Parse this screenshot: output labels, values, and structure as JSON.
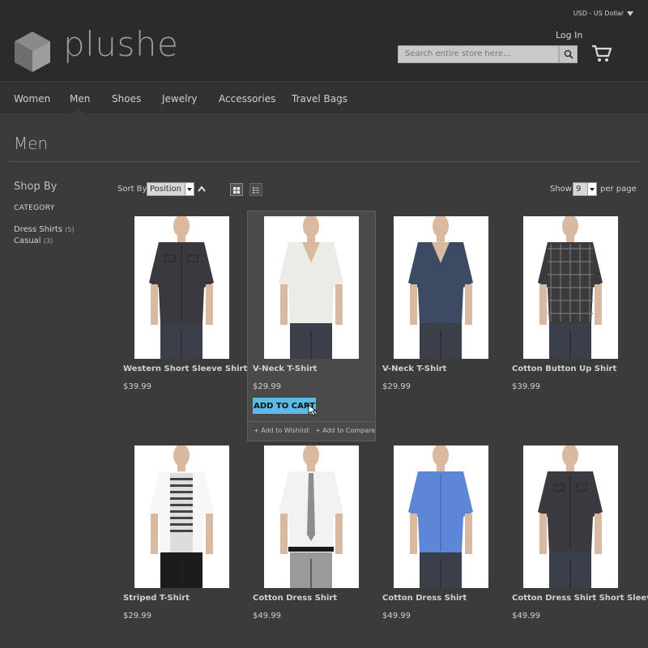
{
  "header": {
    "brand": "plushe",
    "currency": "USD - US Dollar",
    "login": "Log In",
    "search_placeholder": "Search entire store here..."
  },
  "nav": {
    "items": [
      "Women",
      "Men",
      "Shoes",
      "Jewelry",
      "Accessories",
      "Travel Bags"
    ],
    "active": "Men"
  },
  "page": {
    "title": "Men"
  },
  "sidebar": {
    "heading": "Shop By",
    "category_label": "CATEGORY",
    "categories": [
      {
        "label": "Dress Shirts",
        "count": "(5)"
      },
      {
        "label": "Casual",
        "count": "(3)"
      }
    ]
  },
  "toolbar": {
    "sort_label": "Sort By",
    "sort_value": "Position",
    "show_label": "Show",
    "show_value": "9",
    "per_page": "per page"
  },
  "products": [
    {
      "name": "Western Short Sleeve Shirt",
      "price": "$39.99",
      "shirt_color": "#3a3940",
      "style": "dark-button"
    },
    {
      "name": "V-Neck T-Shirt",
      "price": "$29.99",
      "shirt_color": "#ecebe6",
      "style": "vneck"
    },
    {
      "name": "V-Neck T-Shirt",
      "price": "$29.99",
      "shirt_color": "#3c4a63",
      "style": "vneck"
    },
    {
      "name": "Cotton Button Up Shirt",
      "price": "$39.99",
      "shirt_color": "#3b3b3d",
      "style": "plaid"
    },
    {
      "name": "Striped T-Shirt",
      "price": "$29.99",
      "shirt_color": "#f4f4f4",
      "style": "blazer"
    },
    {
      "name": "Cotton Dress Shirt",
      "price": "$49.99",
      "shirt_color": "#f2f2f2",
      "style": "dress-tie"
    },
    {
      "name": "Cotton Dress Shirt",
      "price": "$49.99",
      "shirt_color": "#5d86d6",
      "style": "dress-blue"
    },
    {
      "name": "Cotton Dress Shirt Short Sleeve",
      "price": "$49.99",
      "shirt_color": "#3b3a40",
      "style": "dark-button"
    }
  ],
  "hover_card": {
    "add_to_cart": "ADD TO CART",
    "wishlist": "+ Add to Wishlist",
    "compare": "+ Add to Compare"
  }
}
